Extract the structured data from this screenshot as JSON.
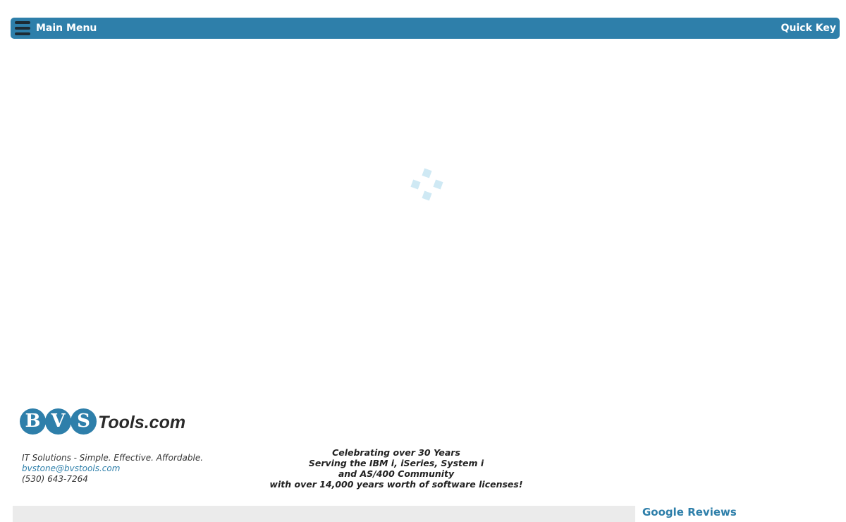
{
  "header": {
    "menu_label": "Main Menu",
    "quick_key_label": "Quick Key",
    "menu_icon": "hamburger-icon",
    "bar_color": "#2e7faa"
  },
  "loading": {
    "icon": "loading-spinner-icon",
    "color": "#cfe9f4"
  },
  "footer": {
    "logo": {
      "letters": [
        "B",
        "V",
        "S"
      ],
      "suffix": "Tools.com"
    },
    "tagline": "IT Solutions - Simple. Effective. Affordable.",
    "email": "bvstone@bvstools.com",
    "phone": "(530) 643-7264",
    "celebrate_lines": [
      "Celebrating over 30 Years",
      "Serving the IBM i, iSeries, System i",
      "and AS/400 Community",
      "with over 14,000 years worth of software licenses!"
    ],
    "reviews_label": "Google Reviews"
  }
}
